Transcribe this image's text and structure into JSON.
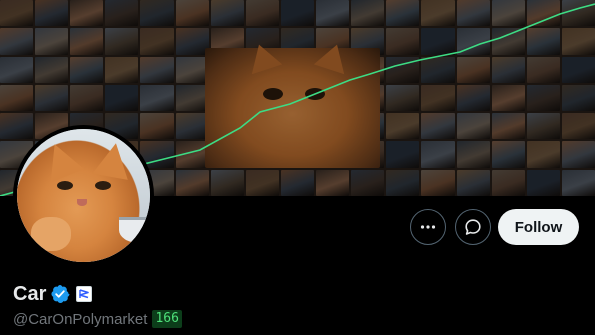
{
  "banner": {
    "colors": [
      "#7a5a3c",
      "#4b5563",
      "#8b6b4a",
      "#3f4a5a",
      "#6b4d3a",
      "#5a6472",
      "#a07050",
      "#2f3a4a",
      "#8a7a6a",
      "#4a3a30",
      "#6a7482",
      "#9a6a4a",
      "#3a4552",
      "#7a6a5a",
      "#5a4a3a",
      "#8a5a3a",
      "#4a5a6a"
    ],
    "chart_line_color": "#3ddc84"
  },
  "profile": {
    "display_name": "Car",
    "handle": "@CarOnPolymarket",
    "score": "166",
    "verified_color": "#1d9bf0"
  },
  "actions": {
    "follow_label": "Follow"
  }
}
